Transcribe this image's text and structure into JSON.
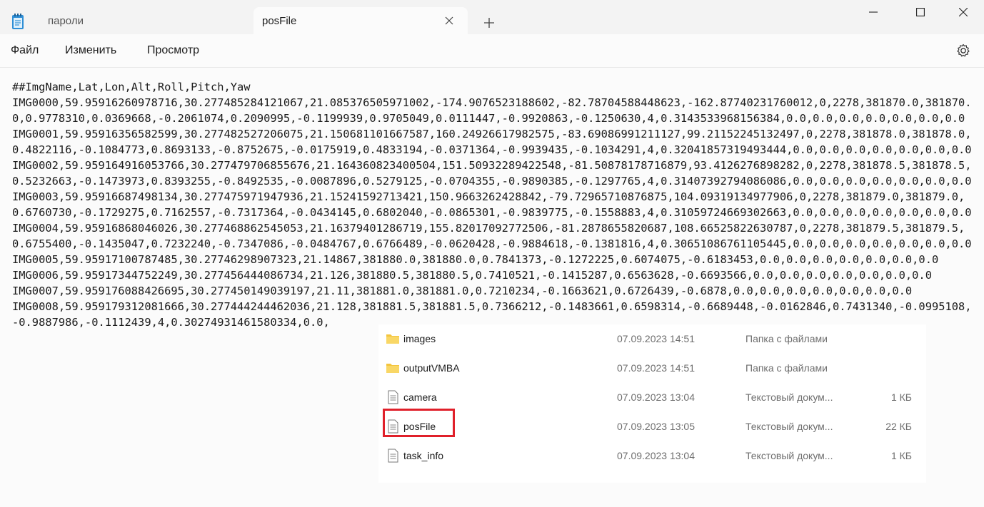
{
  "tabs": [
    {
      "label": "пароли",
      "active": false
    },
    {
      "label": "posFile",
      "active": true
    }
  ],
  "menu": {
    "file": "Файл",
    "edit": "Изменить",
    "view": "Просмотр"
  },
  "editor": {
    "content": "##ImgName,Lat,Lon,Alt,Roll,Pitch,Yaw\nIMG0000,59.95916260978716,30.277485284121067,21.085376505971002,-174.9076523188602,-82.78704588448623,-162.87740231760012,0,2278,381870.0,381870.0,0.9778310,0.0369668,-0.2061074,0.2090995,-0.1199939,0.9705049,0.0111447,-0.9920863,-0.1250630,4,0.3143533968156384,0.0,0.0,0.0,0.0,0.0,0.0,0.0\nIMG0001,59.95916356582599,30.277482527206075,21.150681101667587,160.24926617982575,-83.69086991211127,99.21152245132497,0,2278,381878.0,381878.0,0.4822116,-0.1084773,0.8693133,-0.8752675,-0.0175919,0.4833194,-0.0371364,-0.9939435,-0.1034291,4,0.32041857319493444,0.0,0.0,0.0,0.0,0.0,0.0,0.0\nIMG0002,59.959164916053766,30.277479706855676,21.164360823400504,151.50932289422548,-81.50878178716879,93.4126276898282,0,2278,381878.5,381878.5,0.5232663,-0.1473973,0.8393255,-0.8492535,-0.0087896,0.5279125,-0.0704355,-0.9890385,-0.1297765,4,0.31407392794086086,0.0,0.0,0.0,0.0,0.0,0.0,0.0\nIMG0003,59.95916687498134,30.277475971947936,21.15241592713421,150.9663262428842,-79.72965710876875,104.09319134977906,0,2278,381879.0,381879.0,0.6760730,-0.1729275,0.7162557,-0.7317364,-0.0434145,0.6802040,-0.0865301,-0.9839775,-0.1558883,4,0.31059724669302663,0.0,0.0,0.0,0.0,0.0,0.0,0.0\nIMG0004,59.95916868046026,30.277468862545053,21.16379401286719,155.82017092772506,-81.2878655820687,108.66525822630787,0,2278,381879.5,381879.5,0.6755400,-0.1435047,0.7232240,-0.7347086,-0.0484767,0.6766489,-0.0620428,-0.9884618,-0.1381816,4,0.30651086761105445,0.0,0.0,0.0,0.0,0.0,0.0,0.0\nIMG0005,59.95917100787485,30.27746298907323,21.14867,381880.0,381880.0,0.7841373,-0.1272225,0.6074075,-0.6183453,0.0,0.0,0.0,0.0,0.0,0.0,0.0\nIMG0006,59.95917344752249,30.277456444086734,21.126,381880.5,381880.5,0.7410521,-0.1415287,0.6563628,-0.6693566,0.0,0.0,0.0,0.0,0.0,0.0,0.0\nIMG0007,59.959176088426695,30.277450149039197,21.11,381881.0,381881.0,0.7210234,-0.1663621,0.6726439,-0.6878,0.0,0.0,0.0,0.0,0.0,0.0,0.0\nIMG0008,59.959179312081666,30.277444244462036,21.128,381881.5,381881.5,0.7366212,-0.1483661,0.6598314,-0.6689448,-0.0162846,0.7431340,-0.0995108,-0.9887986,-0.1112439,4,0.30274931461580334,0.0,"
  },
  "explorer": {
    "rows": [
      {
        "name": "images",
        "date": "07.09.2023 14:51",
        "type": "Папка с файлами",
        "size": "",
        "icon": "folder-icon"
      },
      {
        "name": "outputVMBA",
        "date": "07.09.2023 14:51",
        "type": "Папка с файлами",
        "size": "",
        "icon": "folder-icon"
      },
      {
        "name": "camera",
        "date": "07.09.2023 13:04",
        "type": "Текстовый докум...",
        "size": "1 КБ",
        "icon": "text-file-icon"
      },
      {
        "name": "posFile",
        "date": "07.09.2023 13:05",
        "type": "Текстовый докум...",
        "size": "22 КБ",
        "icon": "text-file-icon"
      },
      {
        "name": "task_info",
        "date": "07.09.2023 13:04",
        "type": "Текстовый докум...",
        "size": "1 КБ",
        "icon": "text-file-icon"
      }
    ],
    "highlighted_row": "posFile",
    "highlight_color": "#e0202a"
  },
  "colors": {
    "folder": "#f4c53e",
    "accent_highlight": "#e0202a"
  }
}
